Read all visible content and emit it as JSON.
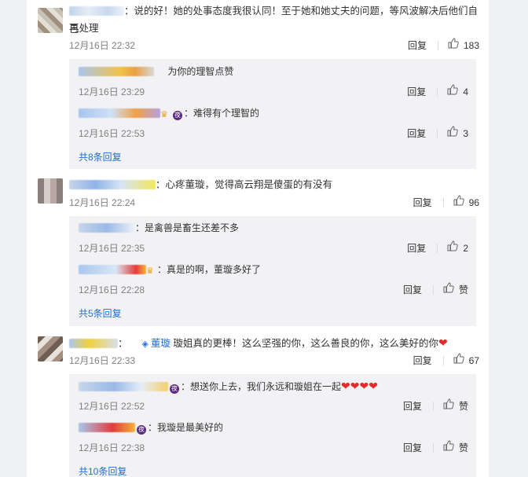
{
  "comments": [
    {
      "text": "：说的好！她的处事态度我很认同！至于她和她丈夫的问题，等风波解决后他们自己",
      "text2": "再处理",
      "time": "12月16日 22:32",
      "reply_label": "回复",
      "likes": "183",
      "replies": [
        {
          "text": "为你的理智点赞",
          "time": "12月16日 23:29",
          "reply_label": "回复",
          "likes": "4"
        },
        {
          "text": "：难得有个理智的",
          "time": "12月16日 22:53",
          "reply_label": "回复",
          "likes": "3"
        }
      ],
      "more": "共8条回复"
    },
    {
      "text": "：心疼董璇，觉得高云翔是傻蛋的有没有",
      "time": "12月16日 22:24",
      "reply_label": "回复",
      "likes": "96",
      "replies": [
        {
          "text": "：是禽兽是畜生还差不多",
          "time": "12月16日 22:35",
          "reply_label": "回复",
          "likes": "2"
        },
        {
          "text": "：真是的啊，董璇多好了",
          "time": "12月16日 22:28",
          "reply_label": "回复",
          "likes": "赞"
        }
      ],
      "more": "共5条回复"
    },
    {
      "prefix": "：",
      "mention": "董璇",
      "text": " 璇姐真的更棒！这么坚强的你，这么善良的你，这么美好的你",
      "time": "12月16日 22:33",
      "reply_label": "回复",
      "likes": "67",
      "replies": [
        {
          "text": "：想送你上去，我们永远和璇姐在一起",
          "time": "12月16日 22:52",
          "reply_label": "回复",
          "likes": "赞"
        },
        {
          "text": "：我璇是最美好的",
          "time": "12月16日 22:38",
          "reply_label": "回复",
          "likes": "赞"
        }
      ],
      "more": "共10条回复"
    }
  ],
  "icons": {
    "like": "thumbs-up-icon",
    "badge": "夜",
    "mention": "weibo-link-icon",
    "heart": "heart-icon"
  },
  "colors": {
    "link": "#1f6fd0",
    "reply_box": "#f2f2f5",
    "heart": "#e62a2a"
  }
}
